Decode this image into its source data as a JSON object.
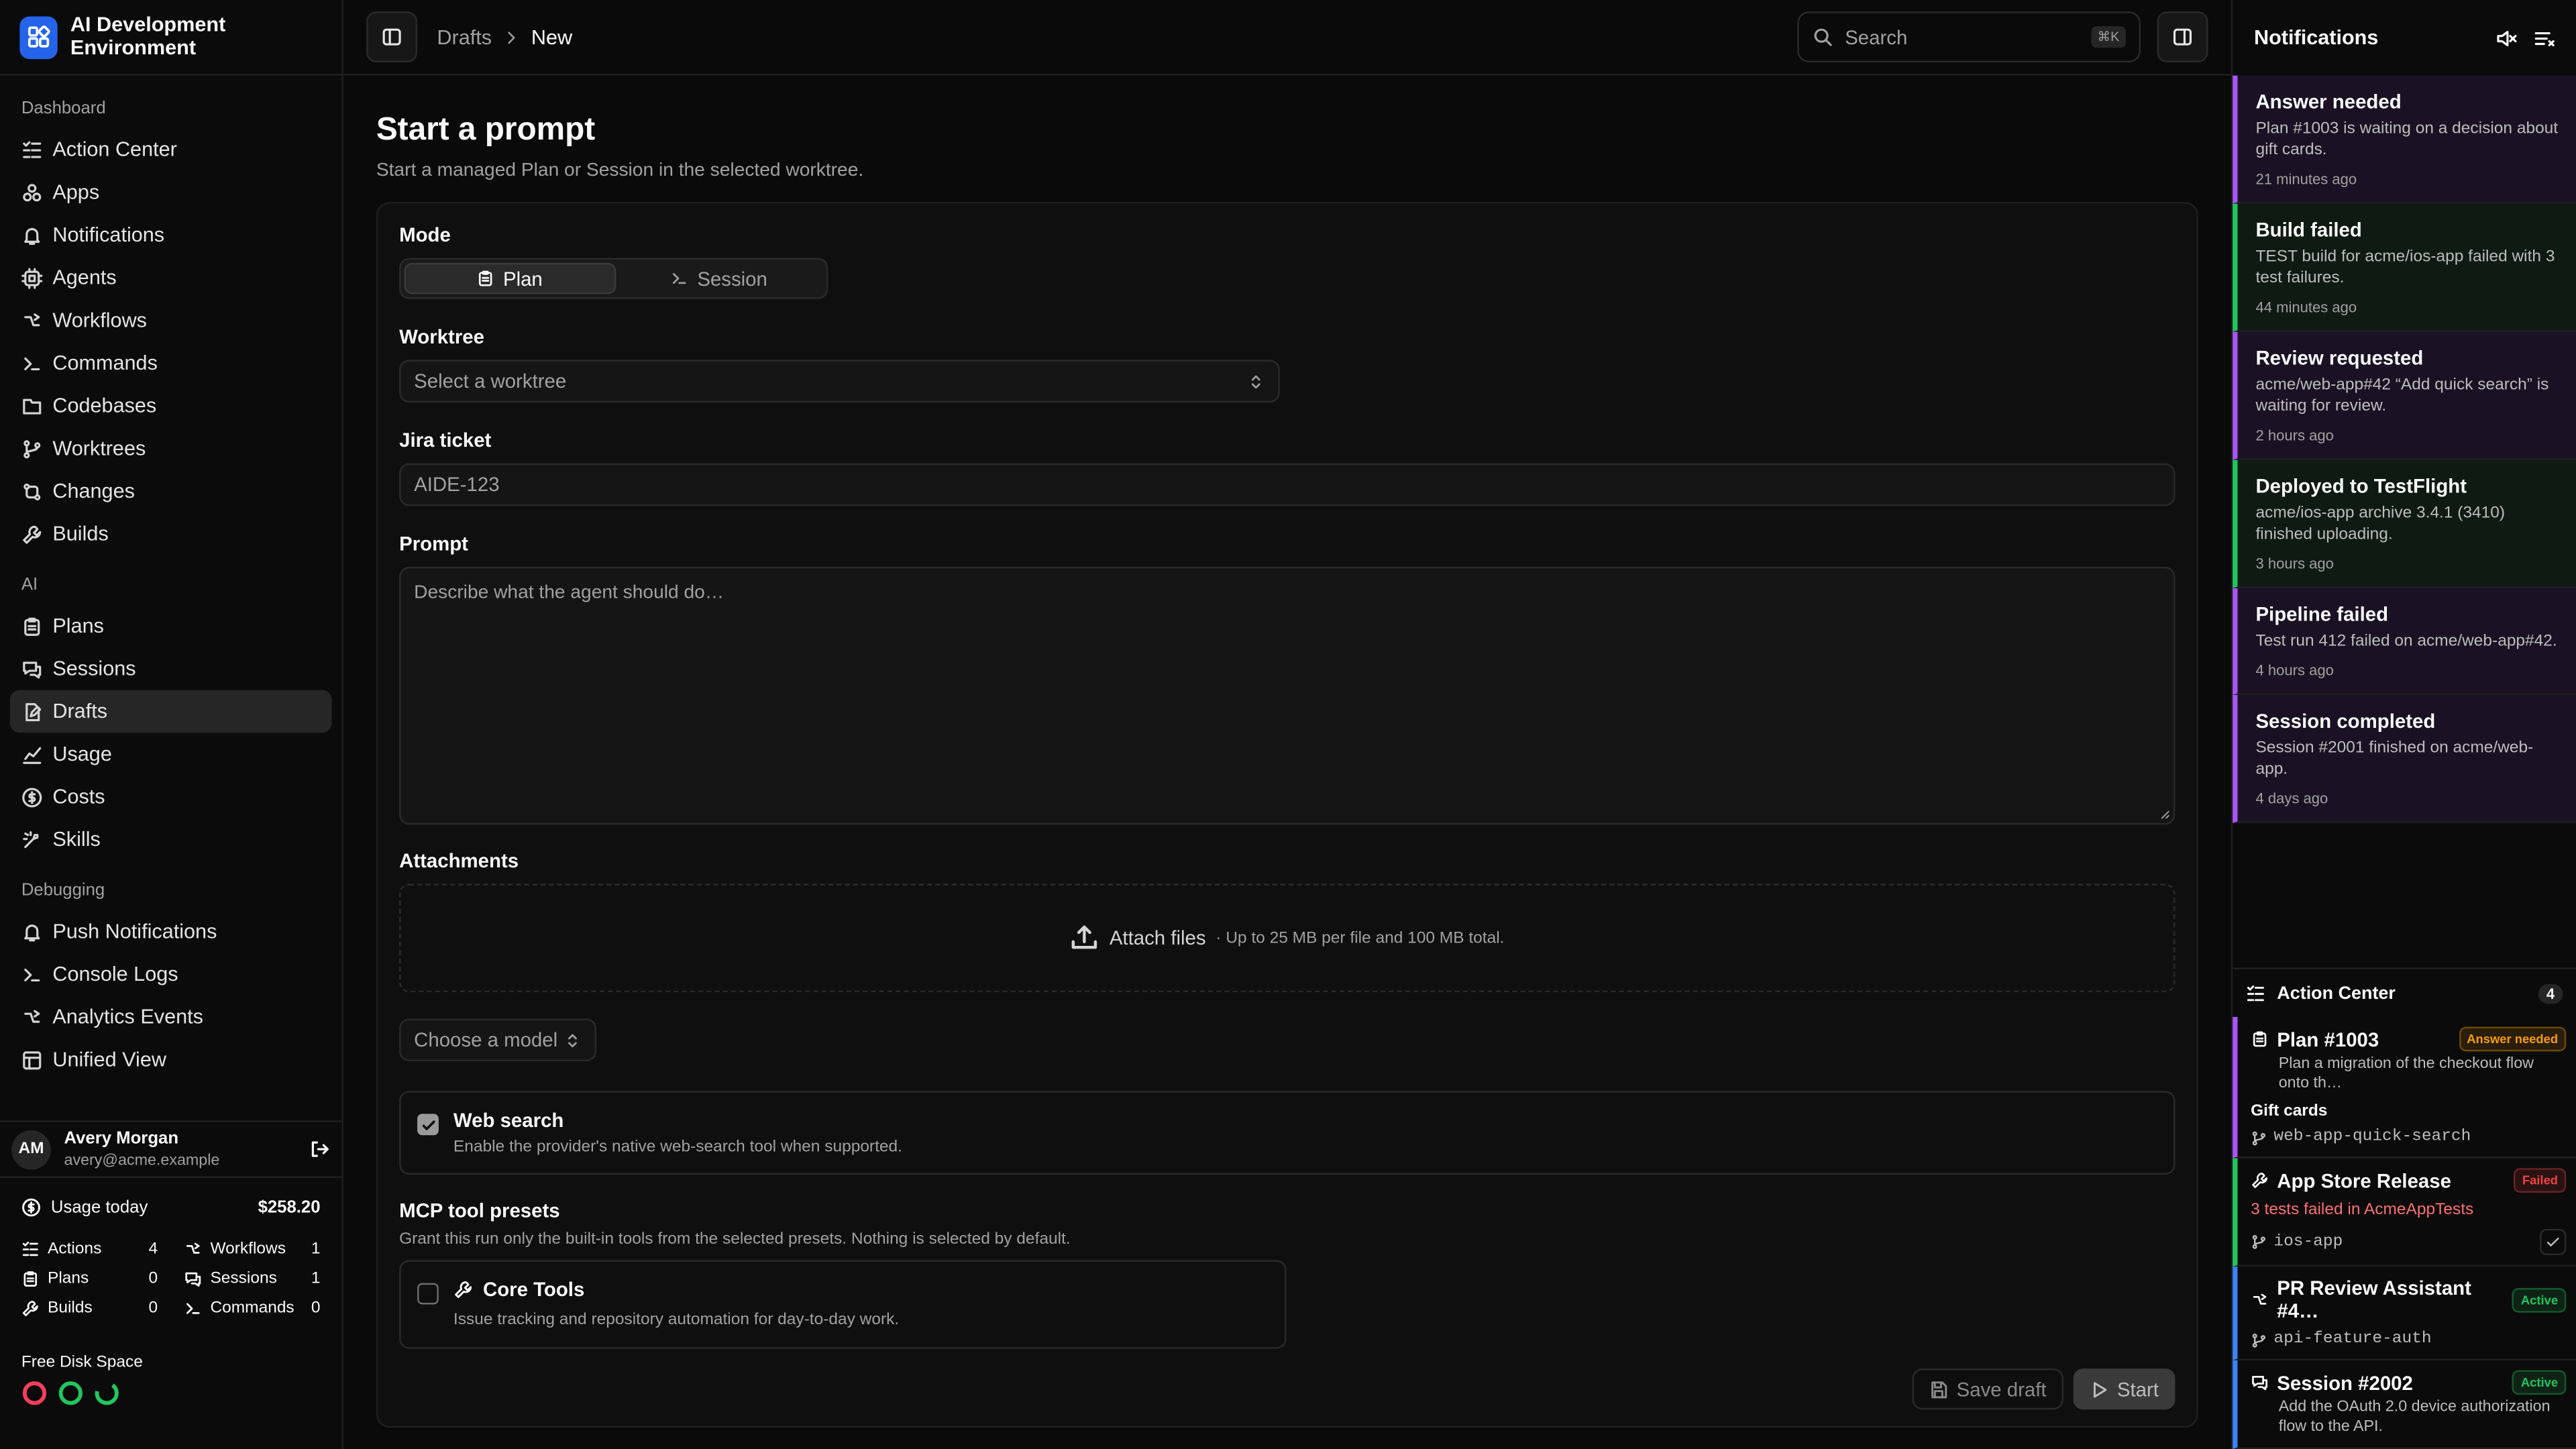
{
  "app": {
    "name": "AI Development Environment"
  },
  "sidebar": {
    "groups": [
      {
        "label": "Dashboard",
        "items": [
          "Action Center",
          "Apps",
          "Notifications",
          "Agents",
          "Workflows",
          "Commands",
          "Codebases",
          "Worktrees",
          "Changes",
          "Builds"
        ]
      },
      {
        "label": "AI",
        "items": [
          "Plans",
          "Sessions",
          "Drafts",
          "Usage",
          "Costs",
          "Skills"
        ]
      },
      {
        "label": "Debugging",
        "items": [
          "Push Notifications",
          "Console Logs",
          "Analytics Events",
          "Unified View"
        ]
      }
    ],
    "active_item": "Drafts"
  },
  "user": {
    "initials": "AM",
    "name": "Avery Morgan",
    "email": "avery@acme.example"
  },
  "usage": {
    "label": "Usage today",
    "amount": "$258.20",
    "stats": [
      {
        "label": "Actions",
        "value": "4"
      },
      {
        "label": "Workflows",
        "value": "1"
      },
      {
        "label": "Plans",
        "value": "0"
      },
      {
        "label": "Sessions",
        "value": "1"
      },
      {
        "label": "Builds",
        "value": "0"
      },
      {
        "label": "Commands",
        "value": "0"
      }
    ],
    "disk_label": "Free Disk Space",
    "disk_colors": [
      "#f43f5e",
      "#22c55e",
      "#22c55e"
    ]
  },
  "topbar": {
    "breadcrumb": [
      "Drafts",
      "New"
    ],
    "search_placeholder": "Search",
    "search_shortcut": "⌘K"
  },
  "form": {
    "title": "Start a prompt",
    "subtitle": "Start a managed Plan or Session in the selected worktree.",
    "mode_label": "Mode",
    "mode_options": [
      "Plan",
      "Session"
    ],
    "mode_selected": "Plan",
    "worktree_label": "Worktree",
    "worktree_placeholder": "Select a worktree",
    "jira_label": "Jira ticket",
    "jira_placeholder": "AIDE-123",
    "prompt_label": "Prompt",
    "prompt_placeholder": "Describe what the agent should do…",
    "attachments_label": "Attachments",
    "attach_text": "Attach files",
    "attach_hint": "· Up to 25 MB per file and 100 MB total.",
    "model_placeholder": "Choose a model",
    "web_search_title": "Web search",
    "web_search_desc": "Enable the provider's native web-search tool when supported.",
    "web_search_checked": true,
    "mcp_label": "MCP tool presets",
    "mcp_desc": "Grant this run only the built-in tools from the selected presets. Nothing is selected by default.",
    "core_tools_title": "Core Tools",
    "core_tools_desc": "Issue tracking and repository automation for day-to-day work.",
    "core_tools_checked": false,
    "save_draft": "Save draft",
    "start": "Start"
  },
  "notifications": {
    "title": "Notifications",
    "items": [
      {
        "title": "Answer needed",
        "body": "Plan #1003 is waiting on a decision about gift cards.",
        "time": "21 minutes ago",
        "color": "#a855f7",
        "bg": "#1a1224"
      },
      {
        "title": "Build failed",
        "body": "TEST build for acme/ios-app failed with 3 test failures.",
        "time": "44 minutes ago",
        "color": "#22c55e",
        "bg": "#0f1a13"
      },
      {
        "title": "Review requested",
        "body": "acme/web-app#42 “Add quick search” is waiting for review.",
        "time": "2 hours ago",
        "color": "#a855f7",
        "bg": "#1a1224"
      },
      {
        "title": "Deployed to TestFlight",
        "body": "acme/ios-app archive 3.4.1 (3410) finished uploading.",
        "time": "3 hours ago",
        "color": "#22c55e",
        "bg": "#0f1a13"
      },
      {
        "title": "Pipeline failed",
        "body": "Test run 412 failed on acme/web-app#42.",
        "time": "4 hours ago",
        "color": "#a855f7",
        "bg": "#1a1224"
      },
      {
        "title": "Session completed",
        "body": "Session #2001 finished on acme/web-app.",
        "time": "4 days ago",
        "color": "#a855f7",
        "bg": "#1a1224"
      }
    ]
  },
  "action_center": {
    "title": "Action Center",
    "count": "4",
    "items": [
      {
        "title": "Plan #1003",
        "tag": "Answer needed",
        "desc": "Plan a migration of the checkout flow onto th…",
        "extra": "Gift cards",
        "branch": "web-app-quick-search",
        "color": "#a855f7",
        "tag_color": "#f59e0b"
      },
      {
        "title": "App Store Release",
        "tag": "Failed",
        "desc": "3 tests failed in AcmeAppTests",
        "branch": "ios-app",
        "color": "#22c55e",
        "tag_color": "#ef4444"
      },
      {
        "title": "PR Review Assistant #4…",
        "tag": "Active",
        "branch": "api-feature-auth",
        "color": "#3b82f6",
        "tag_color": "#22c55e"
      },
      {
        "title": "Session #2002",
        "tag": "Active",
        "desc": "Add the OAuth 2.0 device authorization flow to the API.",
        "color": "#3b82f6",
        "tag_color": "#22c55e"
      }
    ]
  }
}
